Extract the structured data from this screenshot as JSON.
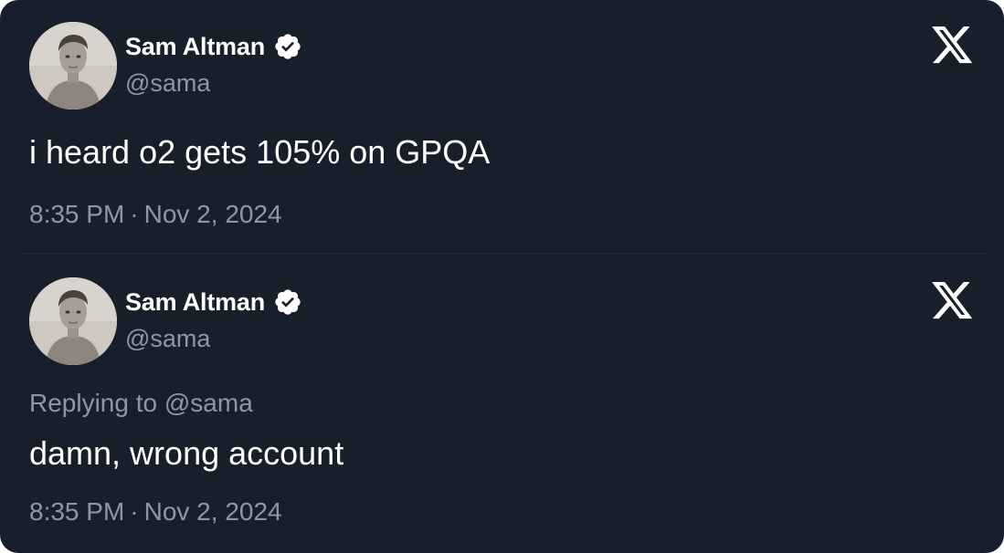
{
  "colors": {
    "background": "#17202a",
    "primary_text": "#ffffff",
    "secondary_text": "#8b98a5",
    "verified_badge": "#ffffff"
  },
  "tweets": [
    {
      "author_name": "Sam Altman",
      "handle": "@sama",
      "verified": true,
      "avatar_icon": "profile-photo",
      "brand_icon": "x-logo-icon",
      "reply_prefix": "",
      "reply_to": "",
      "text": "i heard o2 gets 105% on GPQA",
      "time": "8:35 PM",
      "separator": "·",
      "date": "Nov 2, 2024"
    },
    {
      "author_name": "Sam Altman",
      "handle": "@sama",
      "verified": true,
      "avatar_icon": "profile-photo",
      "brand_icon": "x-logo-icon",
      "reply_prefix": "Replying to",
      "reply_to": "@sama",
      "text": "damn, wrong account",
      "time": "8:35 PM",
      "separator": "·",
      "date": "Nov 2, 2024"
    }
  ]
}
